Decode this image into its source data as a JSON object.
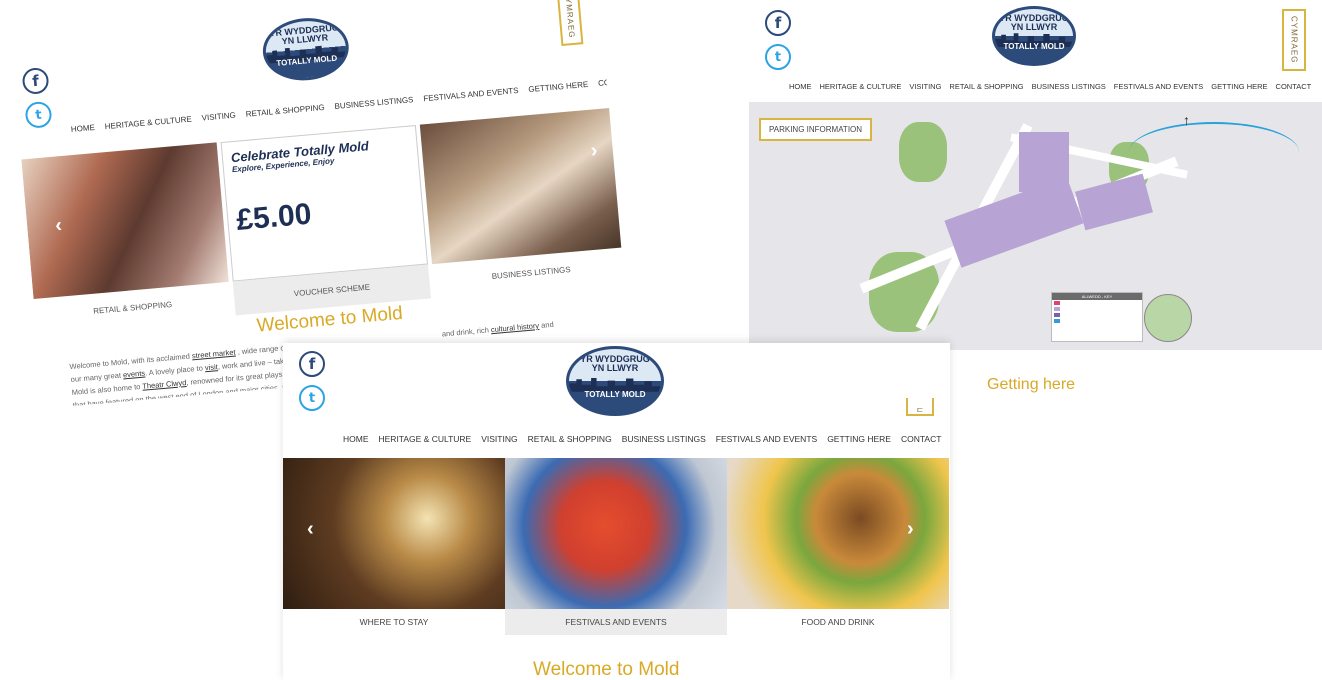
{
  "site": {
    "logo_line1": "YR WYDDGRUG",
    "logo_line2": "YN LLWYR",
    "logo_line3": "TOTALLY MOLD",
    "cymraeg": "CYMRAEG",
    "facebook_glyph": "f",
    "twitter_glyph": "t",
    "nav": [
      "HOME",
      "HERITAGE & CULTURE",
      "VISITING",
      "RETAIL & SHOPPING",
      "BUSINESS LISTINGS",
      "FESTIVALS AND EVENTS",
      "GETTING HERE",
      "CONTACT"
    ],
    "welcome": "Welcome to Mold"
  },
  "panel1": {
    "tiles": [
      "RETAIL & SHOPPING",
      "VOUCHER SCHEME",
      "BUSINESS LISTINGS"
    ],
    "voucher": {
      "title": "Celebrate Totally Mold",
      "subtitle": "Explore, Experience, Enjoy",
      "price": "£5.00"
    },
    "intro_start": "Welcome to Mold, with its acclaimed",
    "intro_link": "street market",
    "intro_rest": ", wide range of i",
    "intro_tail": "and drink, rich",
    "intro_link2": "cultural history",
    "intro_end": "and",
    "line2_start": "our many great",
    "line2_link": "events",
    "line2_rest": ". A lovely place to",
    "line2_link2": "visit",
    "line2_end": ", work and live – take t",
    "line3_start": "Mold is also home to",
    "line3_link": "Theatr Clwyd",
    "line3_rest": ", renowned for its great plays, i",
    "line4": "that have featured on the west end of London and major cities, a"
  },
  "panel2": {
    "parking": "PARKING INFORMATION",
    "getting_here": "Getting here",
    "key_title": "ALLWEDD - KEY"
  },
  "panel3": {
    "tiles": [
      "WHERE TO STAY",
      "FESTIVALS AND EVENTS",
      "FOOD AND DRINK"
    ]
  },
  "icons": {
    "facebook": "facebook-icon",
    "twitter": "twitter-icon",
    "arrow_left": "chevron-left-icon",
    "arrow_right": "chevron-right-icon"
  }
}
